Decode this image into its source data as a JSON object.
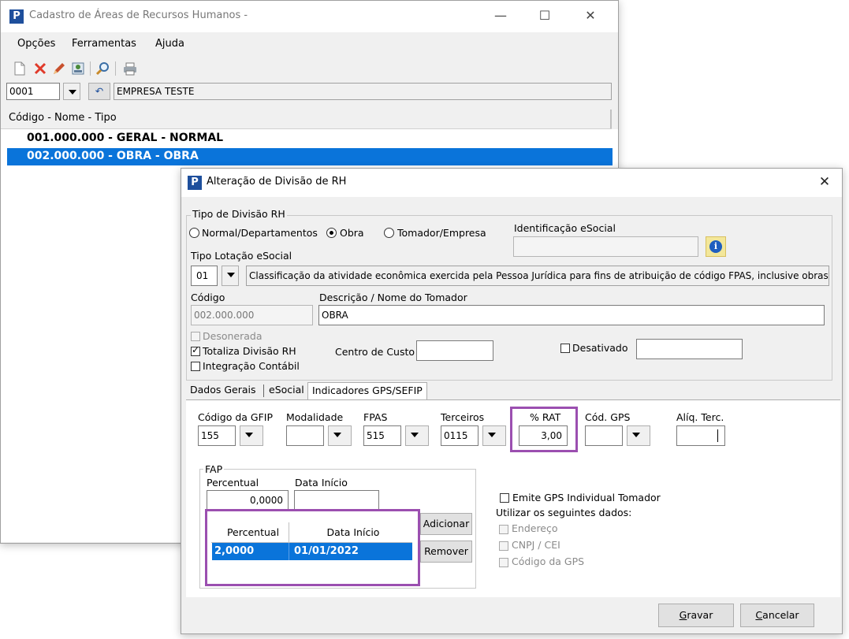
{
  "main_window": {
    "title": "Cadastro de Áreas de Recursos Humanos -",
    "menu": [
      "Opções",
      "Ferramentas",
      "Ajuda"
    ],
    "toolbar_icons": [
      "new-document-icon",
      "delete-x-icon",
      "edit-pencil-icon",
      "report-icon",
      "search-icon",
      "print-icon"
    ],
    "company_code": "0001",
    "company_name": "EMPRESA TESTE",
    "list_header": "Código - Nome - Tipo",
    "list_items": [
      "001.000.000 - GERAL - NORMAL",
      "002.000.000 - OBRA - OBRA"
    ]
  },
  "dialog": {
    "title": "Alteração de Divisão de RH",
    "tipo_divisao_group": "Tipo de Divisão RH",
    "radio_normal": "Normal/Departamentos",
    "radio_obra": "Obra",
    "radio_tomador": "Tomador/Empresa",
    "identificacao_label": "Identificação eSocial",
    "tipo_lotacao_label": "Tipo Lotação eSocial",
    "tipo_lotacao_code": "01",
    "tipo_lotacao_desc": "Classificação da atividade econômica exercida pela Pessoa Jurídica para fins de atribuição de código FPAS, inclusive obras",
    "codigo_label": "Código",
    "codigo_value": "002.000.000",
    "descricao_label": "Descrição / Nome do Tomador",
    "descricao_value": "OBRA",
    "desonerada": "Desonerada",
    "totaliza": "Totaliza Divisão RH",
    "integracao": "Integração Contábil",
    "centro_custo_label": "Centro de Custo",
    "desativado": "Desativado",
    "tabs": [
      "Dados Gerais",
      "eSocial",
      "Indicadores GPS/SEFIP"
    ],
    "gfip_label": "Código da GFIP",
    "gfip_value": "155",
    "modalidade_label": "Modalidade",
    "fpas_label": "FPAS",
    "fpas_value": "515",
    "terceiros_label": "Terceiros",
    "terceiros_value": "0115",
    "rat_label": "% RAT",
    "rat_value": "3,00",
    "cod_gps_label": "Cód. GPS",
    "aliq_terc_label": "Alíq. Terc.",
    "fap_group": "FAP",
    "fap_percentual_label": "Percentual",
    "fap_percentual_value": "0,0000",
    "fap_data_label": "Data Início",
    "fap_table": {
      "headers": [
        "Percentual",
        "Data Início"
      ],
      "rows": [
        [
          "2,0000",
          "01/01/2022"
        ]
      ]
    },
    "btn_adicionar": "Adicionar",
    "btn_remover": "Remover",
    "emite_gps": "Emite GPS Individual Tomador",
    "utilizar_label": "Utilizar os seguintes dados:",
    "opt_endereco": "Endereço",
    "opt_cnpj": "CNPJ / CEI",
    "opt_codigo_gps": "Código da GPS",
    "btn_gravar_u": "G",
    "btn_gravar_rest": "ravar",
    "btn_cancelar_u": "C",
    "btn_cancelar_rest": "ancelar"
  }
}
